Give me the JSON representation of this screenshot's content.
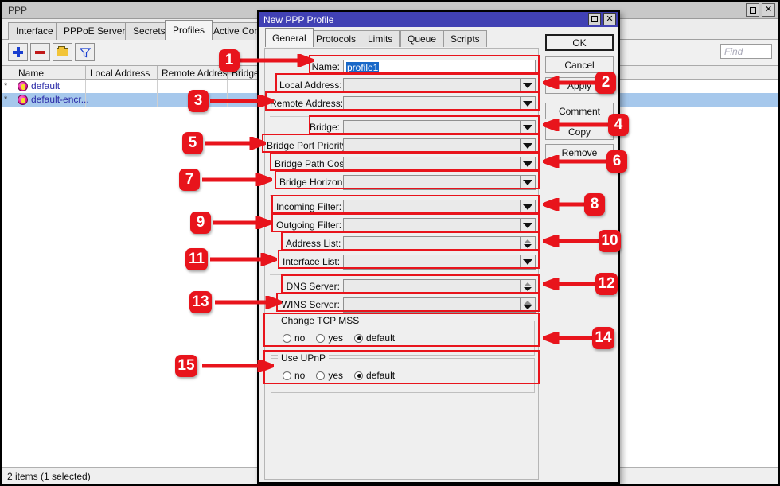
{
  "main_window": {
    "title": "PPP",
    "window_buttons": [
      {
        "name": "maximize",
        "glyph": ""
      },
      {
        "name": "close",
        "glyph": "✕"
      }
    ],
    "tabs": [
      {
        "label": "Interface",
        "active": false
      },
      {
        "label": "PPPoE Servers",
        "active": false
      },
      {
        "label": "Secrets",
        "active": false
      },
      {
        "label": "Profiles",
        "active": true
      },
      {
        "label": "Active Connec",
        "active": false
      }
    ],
    "toolbar": [
      {
        "name": "add-button",
        "icon": "plus-icon"
      },
      {
        "name": "remove-button",
        "icon": "minus-icon"
      },
      {
        "name": "enable-button",
        "icon": "folder-icon"
      },
      {
        "name": "filter-button",
        "icon": "filter-icon"
      }
    ],
    "search": {
      "placeholder": "Find",
      "value": ""
    },
    "table": {
      "columns": [
        "",
        "Name",
        "Local Address",
        "Remote Address",
        "Bridge"
      ],
      "sort_column": "Name",
      "rows": [
        {
          "flag": "*",
          "icon": "profile-key-icon",
          "name": "default",
          "local_address": "",
          "remote_address": "",
          "bridge": "",
          "selected": false
        },
        {
          "flag": "*",
          "icon": "profile-key-icon",
          "name": "default-encr...",
          "local_address": "",
          "remote_address": "",
          "bridge": "",
          "selected": true
        }
      ]
    },
    "status": "2 items (1 selected)"
  },
  "dialog": {
    "title": "New PPP Profile",
    "window_buttons": [
      {
        "name": "maximize",
        "glyph": ""
      },
      {
        "name": "close",
        "glyph": "✕"
      }
    ],
    "tabs": [
      {
        "label": "General",
        "active": true
      },
      {
        "label": "Protocols",
        "active": false
      },
      {
        "label": "Limits",
        "active": false
      },
      {
        "label": "Queue",
        "active": false
      },
      {
        "label": "Scripts",
        "active": false
      }
    ],
    "fields": [
      {
        "label": "Name:",
        "value": "profile1",
        "control": "text",
        "selected_text": true
      },
      {
        "label": "Local Address:",
        "value": "",
        "control": "dropdown"
      },
      {
        "label": "Remote Address:",
        "value": "",
        "control": "dropdown"
      },
      {
        "label": "Bridge:",
        "value": "",
        "control": "dropdown"
      },
      {
        "label": "Bridge Port Priority:",
        "value": "",
        "control": "dropdown"
      },
      {
        "label": "Bridge Path Cost:",
        "value": "",
        "control": "dropdown"
      },
      {
        "label": "Bridge Horizon:",
        "value": "",
        "control": "dropdown"
      },
      {
        "label": "Incoming Filter:",
        "value": "",
        "control": "dropdown"
      },
      {
        "label": "Outgoing Filter:",
        "value": "",
        "control": "dropdown"
      },
      {
        "label": "Address List:",
        "value": "",
        "control": "spinner"
      },
      {
        "label": "Interface List:",
        "value": "",
        "control": "dropdown"
      },
      {
        "label": "DNS Server:",
        "value": "",
        "control": "spinner"
      },
      {
        "label": "WINS Server:",
        "value": "",
        "control": "spinner"
      }
    ],
    "groups": [
      {
        "legend": "Change TCP MSS",
        "options": [
          {
            "label": "no",
            "checked": false
          },
          {
            "label": "yes",
            "checked": false
          },
          {
            "label": "default",
            "checked": true
          }
        ]
      },
      {
        "legend": "Use UPnP",
        "options": [
          {
            "label": "no",
            "checked": false
          },
          {
            "label": "yes",
            "checked": false
          },
          {
            "label": "default",
            "checked": true
          }
        ]
      }
    ],
    "buttons": [
      {
        "label": "OK",
        "primary": true
      },
      {
        "label": "Cancel",
        "primary": false
      },
      {
        "label": "Apply",
        "primary": false
      },
      {
        "label": "Comment",
        "primary": false
      },
      {
        "label": "Copy",
        "primary": false
      },
      {
        "label": "Remove",
        "primary": false
      }
    ]
  },
  "annotations": {
    "accent_color": "#e8141c",
    "badges": [
      {
        "number": "1",
        "side": "left"
      },
      {
        "number": "2",
        "side": "right"
      },
      {
        "number": "3",
        "side": "left"
      },
      {
        "number": "4",
        "side": "right"
      },
      {
        "number": "5",
        "side": "left"
      },
      {
        "number": "6",
        "side": "right"
      },
      {
        "number": "7",
        "side": "left"
      },
      {
        "number": "8",
        "side": "right"
      },
      {
        "number": "9",
        "side": "left"
      },
      {
        "number": "10",
        "side": "right"
      },
      {
        "number": "11",
        "side": "left"
      },
      {
        "number": "12",
        "side": "right"
      },
      {
        "number": "13",
        "side": "left"
      },
      {
        "number": "14",
        "side": "right"
      },
      {
        "number": "15",
        "side": "left"
      }
    ]
  }
}
